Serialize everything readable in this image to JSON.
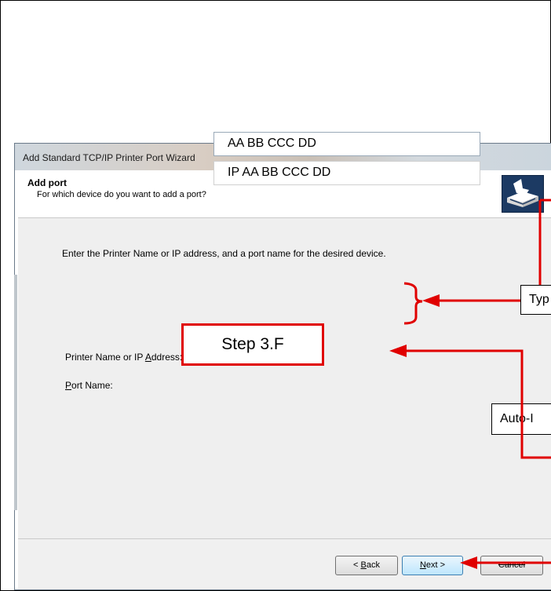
{
  "window": {
    "title": "Add Standard TCP/IP Printer Port Wizard"
  },
  "header": {
    "title": "Add port",
    "subtitle": "For which device do you want to add a port?"
  },
  "content": {
    "instruction": "Enter the Printer Name or IP address, and a port name for the desired device.",
    "printer_label_prefix": "Printer Name or IP ",
    "printer_label_access": "A",
    "printer_label_suffix": "ddress:",
    "printer_value": "AA BB CCC DD",
    "port_label_access": "P",
    "port_label_suffix": "ort Name:",
    "port_value": "IP AA BB CCC DD"
  },
  "annotations": {
    "step_label": "Step 3.F",
    "callout_type": "Typ",
    "callout_auto": "Auto-I"
  },
  "footer": {
    "back_prefix": "< ",
    "back_access": "B",
    "back_suffix": "ack",
    "next_access": "N",
    "next_suffix": "ext >",
    "cancel_label": "Cancel"
  },
  "colors": {
    "annotation_red": "#e00000",
    "icon_navy": "#1c3a63"
  }
}
